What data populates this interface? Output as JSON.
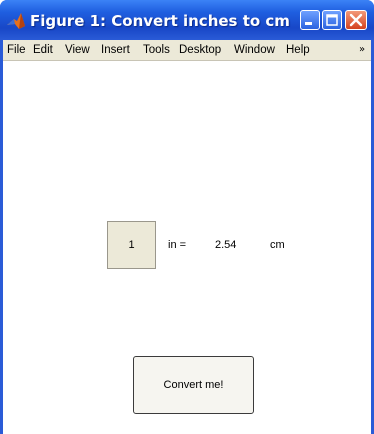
{
  "window": {
    "title": "Figure 1: Convert inches to cm",
    "accent_color": "#2a5bd7",
    "icon": "matlab-icon",
    "controls": {
      "minimize": "minimize-icon",
      "maximize": "maximize-icon",
      "close": "close-icon"
    }
  },
  "menu": {
    "items": [
      "File",
      "Edit",
      "View",
      "Insert",
      "Tools",
      "Desktop",
      "Window",
      "Help"
    ],
    "overflow_icon": "chevron-right-icon"
  },
  "converter": {
    "input_value": "1",
    "input_unit": "in =",
    "result_value": "2.54",
    "result_unit": "cm",
    "button_label": "Convert me!"
  }
}
